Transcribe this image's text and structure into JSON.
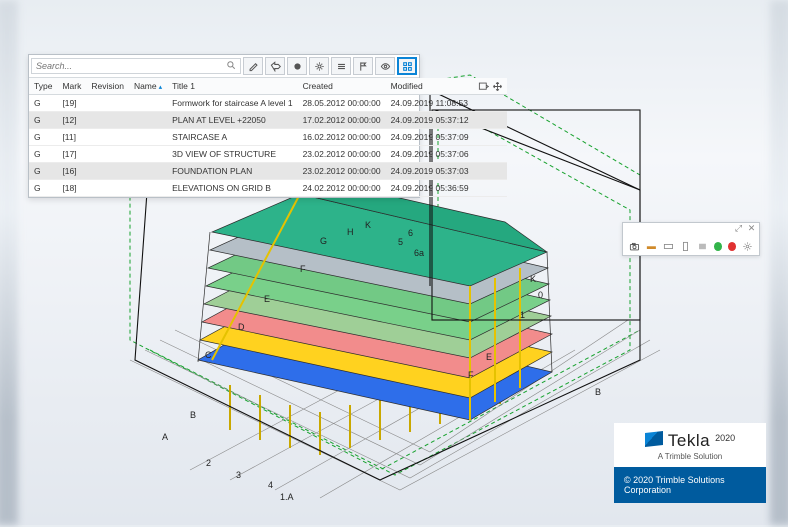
{
  "search": {
    "placeholder": "Search..."
  },
  "toolbar_icons": [
    "pencil",
    "tag-arrow",
    "circle",
    "cog",
    "bars",
    "flag",
    "eye",
    "grid"
  ],
  "columns": {
    "type": "Type",
    "mark": "Mark",
    "revision": "Revision",
    "name": "Name",
    "title1": "Title 1",
    "created": "Created",
    "modified": "Modified"
  },
  "rows": [
    {
      "type": "G",
      "mark": "[19]",
      "title": "Formwork for staircase A level 1",
      "created": "28.05.2012 00:00:00",
      "modified": "24.09.2019 11:08:53",
      "sel": false
    },
    {
      "type": "G",
      "mark": "[12]",
      "title": "PLAN AT LEVEL +22050",
      "created": "17.02.2012 00:00:00",
      "modified": "24.09.2019 05:37:12",
      "sel": true
    },
    {
      "type": "G",
      "mark": "[11]",
      "title": "STAIRCASE A",
      "created": "16.02.2012 00:00:00",
      "modified": "24.09.2019 05:37:09",
      "sel": false
    },
    {
      "type": "G",
      "mark": "[17]",
      "title": "3D VIEW OF STRUCTURE",
      "created": "23.02.2012 00:00:00",
      "modified": "24.09.2019 05:37:06",
      "sel": false
    },
    {
      "type": "G",
      "mark": "[16]",
      "title": "FOUNDATION PLAN",
      "created": "23.02.2012 00:00:00",
      "modified": "24.09.2019 05:37:03",
      "sel": true
    },
    {
      "type": "G",
      "mark": "[18]",
      "title": "ELEVATIONS ON GRID B",
      "created": "24.02.2012 00:00:00",
      "modified": "24.09.2019 05:36:59",
      "sel": false
    }
  ],
  "grid_labels": [
    "A",
    "B",
    "C",
    "D",
    "E",
    "F",
    "G",
    "H",
    "K",
    "0",
    "1",
    "2",
    "3",
    "4",
    "5",
    "6",
    "6a",
    "1.A"
  ],
  "snapshot": {
    "icons": [
      "camera",
      "build",
      "rect-h",
      "rect-v",
      "rect-fill"
    ]
  },
  "brand": {
    "name": "Tekla",
    "year": "2020",
    "sub": "A Trimble Solution",
    "copyright": "© 2020 Trimble Solutions Corporation"
  }
}
